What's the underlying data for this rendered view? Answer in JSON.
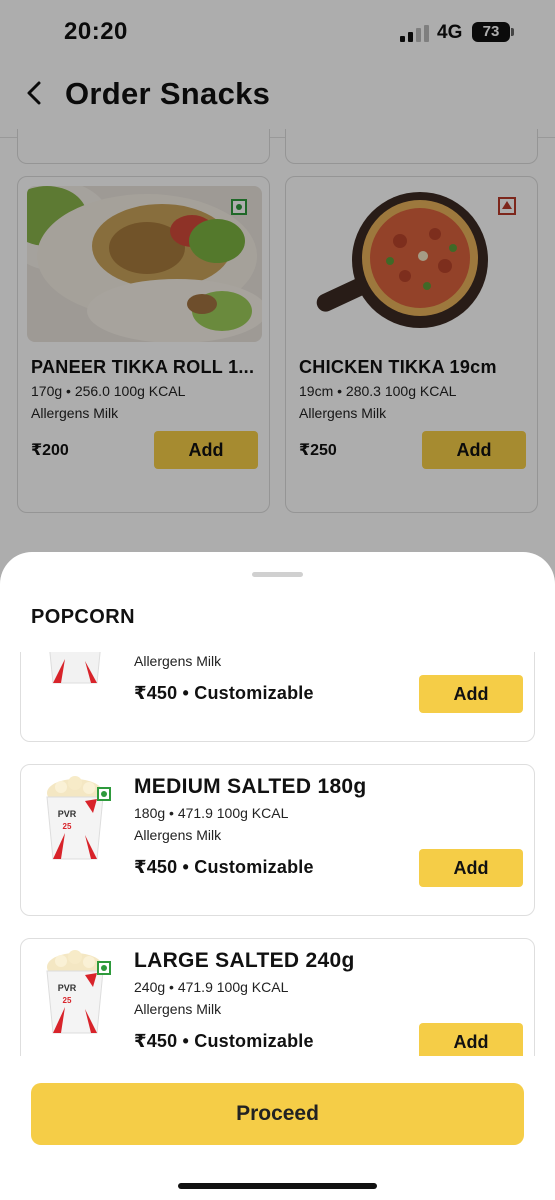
{
  "status_bar": {
    "time": "20:20",
    "network": "4G",
    "battery": "73"
  },
  "header": {
    "title": "Order Snacks"
  },
  "snacks": [
    {
      "name": "PANEER TIKKA ROLL 1...",
      "meta": "170g • 256.0 100g KCAL",
      "allergens": "Allergens Milk",
      "price": "₹200",
      "add_label": "Add",
      "diet": "veg-icon"
    },
    {
      "name": "CHICKEN TIKKA 19cm",
      "meta": "19cm • 280.3 100g KCAL",
      "allergens": "Allergens Milk",
      "price": "₹250",
      "add_label": "Add",
      "diet": "non-veg-icon"
    }
  ],
  "sheet": {
    "title": "POPCORN",
    "items": [
      {
        "name": "",
        "meta": "",
        "allergens": "Allergens Milk",
        "price": "₹450 • Customizable",
        "add_label": "Add"
      },
      {
        "name": "MEDIUM SALTED 180g",
        "meta": "180g • 471.9 100g KCAL",
        "allergens": "Allergens Milk",
        "price": "₹450 • Customizable",
        "add_label": "Add"
      },
      {
        "name": "LARGE SALTED 240g",
        "meta": "240g • 471.9 100g KCAL",
        "allergens": "Allergens Milk",
        "price": "₹450 • Customizable",
        "add_label": "Add"
      }
    ],
    "tub_brand": "PVR",
    "tub_number": "25",
    "proceed_label": "Proceed"
  },
  "colors": {
    "accent": "#f5cd47",
    "veg": "#2e9a3c",
    "non_veg": "#b83a2a"
  }
}
